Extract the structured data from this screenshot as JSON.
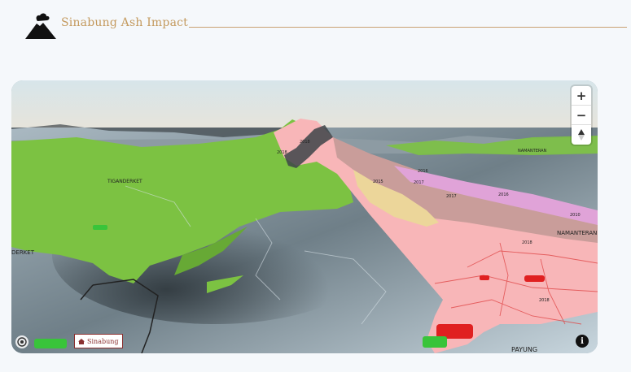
{
  "header": {
    "title": "Sinabung Ash Impact",
    "logo_icon": "volcano-icon",
    "accent_color": "#c49a5e"
  },
  "map": {
    "zoom_in_label": "+",
    "zoom_out_label": "−",
    "compass_icon": "compass-icon",
    "marker_label": "Sinabung",
    "marker_icon": "home-icon",
    "info_label": "i",
    "attribution_icon": "maplibre-icon",
    "place_labels": [
      "TIGANDERKET",
      "DERKET",
      "NAMANTERAN",
      "NAMANTERAN",
      "PAYUNG"
    ],
    "year_labels": [
      "2018",
      "2018",
      "2015",
      "2017",
      "2017",
      "2016",
      "2016",
      "2018",
      "2018",
      "2016",
      "2010"
    ],
    "layer_colors": {
      "vegetation": "#7cc242",
      "ash_2018": "#f8b6b8",
      "ash_2017": "#c99d9a",
      "ash_2015": "#ecd69a",
      "ash_2016": "#e0a3d8",
      "settlement": "#e02020"
    }
  }
}
